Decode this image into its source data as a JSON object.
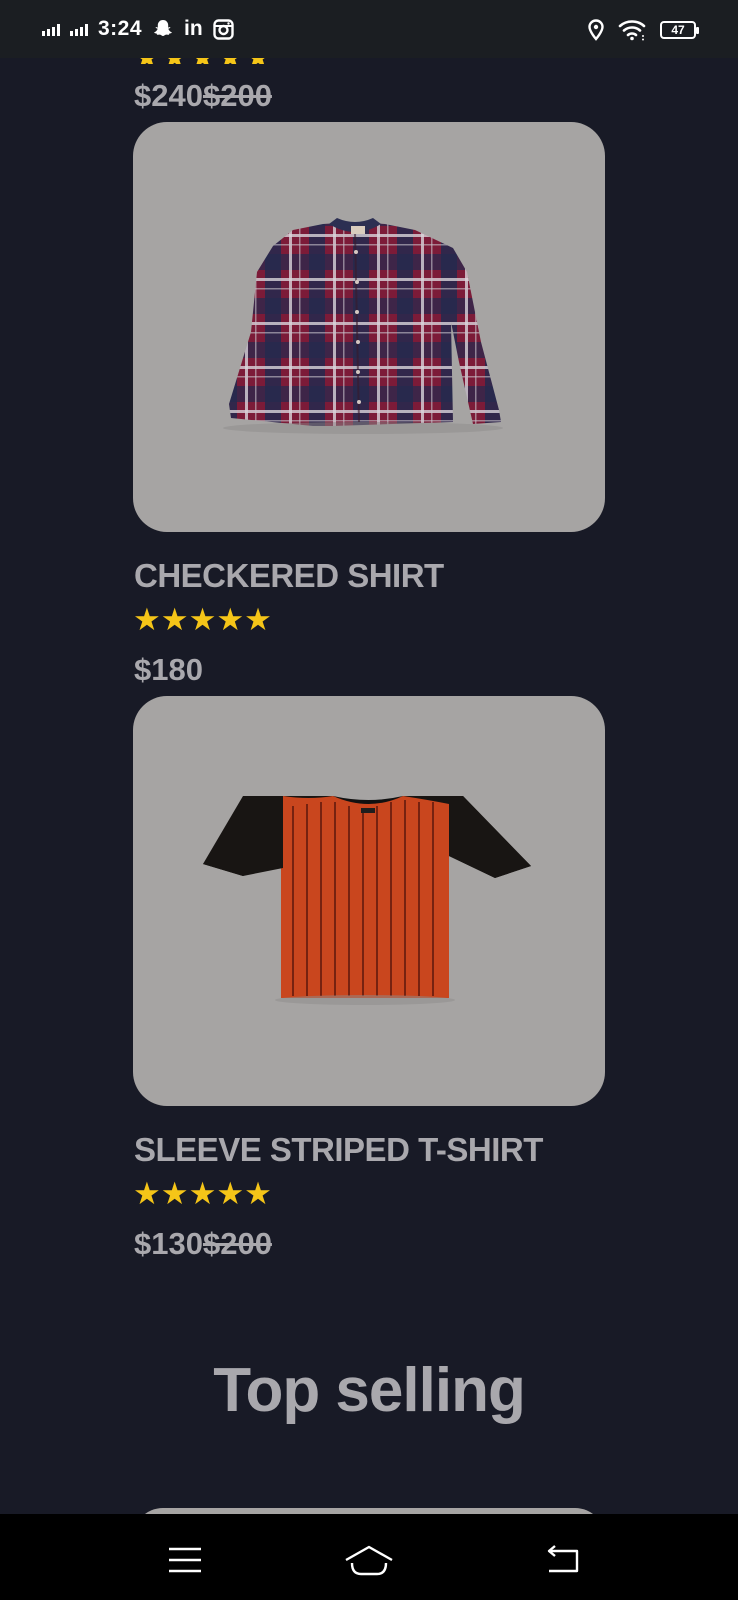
{
  "status_bar": {
    "time": "3:24",
    "linkedin_label": "in",
    "battery": "47",
    "icons": [
      "signal-icon",
      "signal-icon",
      "snapchat-icon",
      "linkedin-icon",
      "instagram-icon",
      "location-icon",
      "wifi-icon",
      "battery-icon"
    ]
  },
  "top_partial": {
    "price": "$240",
    "old_price": "$200",
    "rating_stars": "★★★★★"
  },
  "products": [
    {
      "name": "CHECKERED SHIRT",
      "rating_stars": "★★★★★",
      "rating": 5,
      "price": "$180",
      "old_price": ""
    },
    {
      "name": "SLEEVE STRIPED T-SHIRT",
      "rating_stars": "★★★★★",
      "rating": 5,
      "price": "$130",
      "old_price": "$200"
    }
  ],
  "section": {
    "heading": "Top selling"
  },
  "nav_bar": {
    "icons": [
      "menu-icon",
      "home-icon",
      "back-icon"
    ]
  },
  "colors": {
    "background": "#181a26",
    "card": "#a6a4a3",
    "text": "#a9a8ad",
    "star": "#f5c518",
    "status_bar": "#1b1e22",
    "nav_bar": "#000000"
  }
}
